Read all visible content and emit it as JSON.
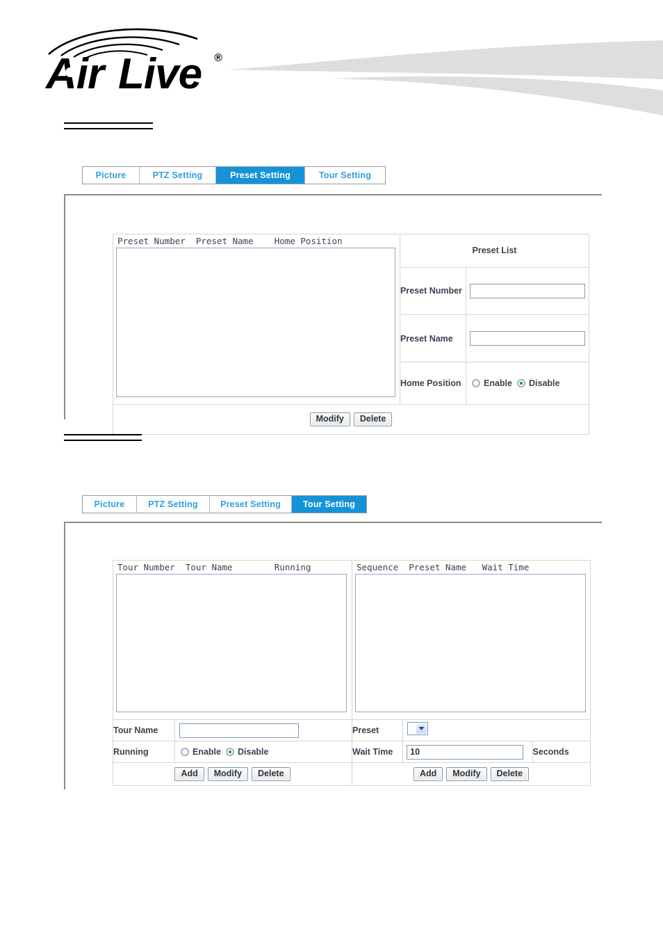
{
  "brand": {
    "name": "AirLive",
    "wordmark": "Air Live",
    "registered_mark": "®",
    "logo_icon": "airlive-wave-logo"
  },
  "sections": [
    {
      "rule_only": true,
      "tabs": {
        "items": [
          {
            "label": "Picture",
            "active": false
          },
          {
            "label": "PTZ Setting",
            "active": false
          },
          {
            "label": "Preset Setting",
            "active": true
          },
          {
            "label": "Tour Setting",
            "active": false
          }
        ]
      },
      "panel": {
        "list": {
          "columns_text": "Preset Number  Preset Name    Home Position",
          "columns": [
            "Preset Number",
            "Preset Name",
            "Home Position"
          ],
          "rows": []
        },
        "form": {
          "title": "Preset List",
          "fields": [
            {
              "label": "Preset Number",
              "type": "text",
              "value": "",
              "placeholder": ""
            },
            {
              "label": "Preset Name",
              "type": "text",
              "value": "",
              "placeholder": ""
            },
            {
              "label": "Home Position",
              "type": "radio",
              "options": [
                {
                  "label": "Enable",
                  "selected": false
                },
                {
                  "label": "Disable",
                  "selected": true
                }
              ]
            }
          ],
          "buttons": [
            "Modify",
            "Delete"
          ]
        }
      }
    },
    {
      "rule_only": true,
      "tabs": {
        "items": [
          {
            "label": "Picture",
            "active": false
          },
          {
            "label": "PTZ Setting",
            "active": false
          },
          {
            "label": "Preset Setting",
            "active": false
          },
          {
            "label": "Tour Setting",
            "active": true
          }
        ]
      },
      "panel": {
        "left": {
          "columns_text": "Tour Number  Tour Name        Running",
          "columns": [
            "Tour Number",
            "Tour Name",
            "Running"
          ],
          "rows": [],
          "fields": [
            {
              "label": "Tour Name",
              "type": "text",
              "value": "",
              "placeholder": ""
            },
            {
              "label": "Running",
              "type": "radio",
              "options": [
                {
                  "label": "Enable",
                  "selected": false
                },
                {
                  "label": "Disable",
                  "selected": true
                }
              ]
            }
          ],
          "buttons": [
            "Add",
            "Modify",
            "Delete"
          ]
        },
        "right": {
          "columns_text": "Sequence  Preset Name   Wait Time",
          "columns": [
            "Sequence",
            "Preset Name",
            "Wait Time"
          ],
          "rows": [],
          "fields": [
            {
              "label": "Preset",
              "type": "select",
              "value": "",
              "options": []
            },
            {
              "label": "Wait Time",
              "type": "text",
              "value": "10",
              "unit": "Seconds"
            }
          ],
          "buttons": [
            "Add",
            "Modify",
            "Delete"
          ]
        }
      }
    }
  ],
  "colors": {
    "tab_active_bg": "#1593d8",
    "tab_text": "#2f9fe0",
    "panel_border": "#8d8b80",
    "input_border": "#7b9bbd",
    "radio_selected_dot": "#1c9c1c",
    "swoosh": "#dedede"
  }
}
